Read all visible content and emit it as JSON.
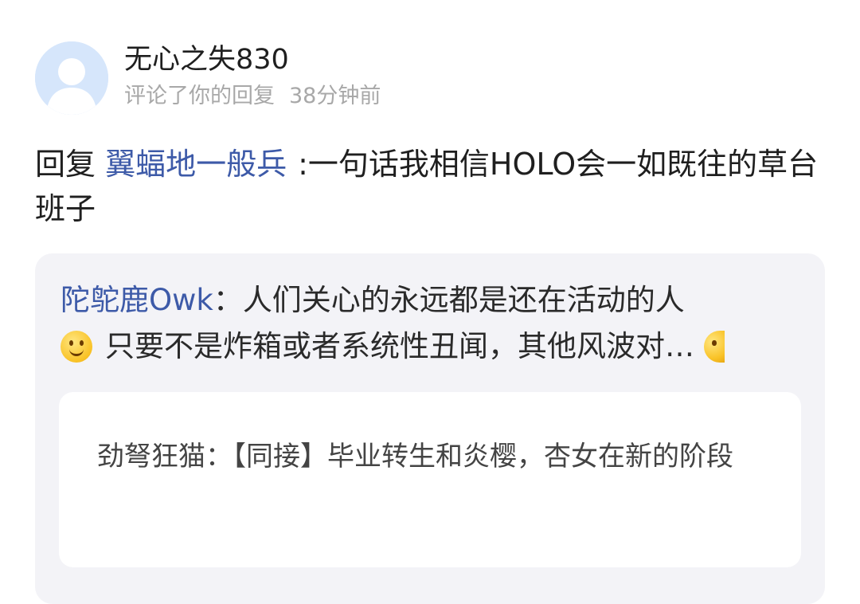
{
  "header": {
    "user_name": "无心之失830",
    "action": "评论了你的回复",
    "time": "38分钟前"
  },
  "reply": {
    "prefix": "回复",
    "mention": "翼蝠地一般兵",
    "text": ":一句话我相信HOLO会一如既往的草台班子"
  },
  "quoted": {
    "author": "陀鸵鹿Owk",
    "separator": "：",
    "line1": "人们关心的永远都是还在活动的人",
    "line2": "只要不是炸箱或者系统性丑闻，其他风波对…",
    "emoji": "smile-emoji"
  },
  "nested": {
    "text": "劲弩狂猫：【同接】毕业转生和炎樱，杏女在新的阶段"
  }
}
